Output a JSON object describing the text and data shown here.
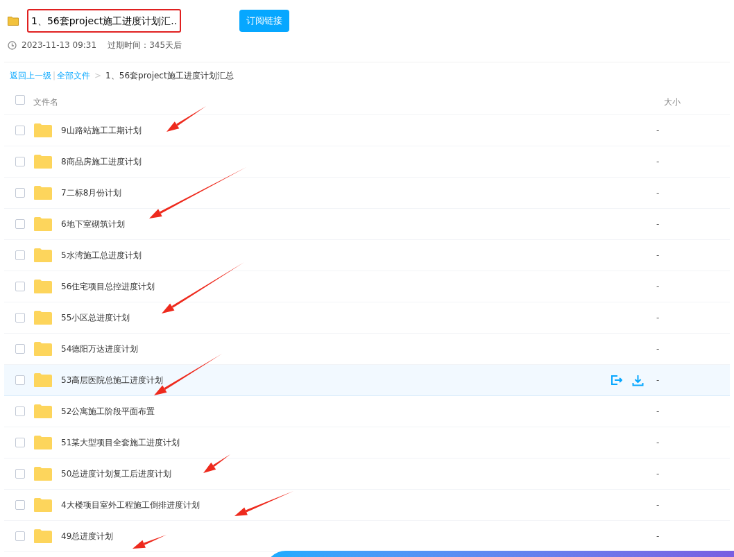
{
  "header": {
    "title": "1、56套project施工进度计划汇..",
    "subscribe_button": "订阅链接",
    "created": "2023-11-13 09:31",
    "expiry": "过期时间：345天后"
  },
  "breadcrumb": {
    "back": "返回上一级",
    "separator": "|",
    "root": "全部文件",
    "arrow": ">",
    "current": "1、56套project施工进度计划汇总"
  },
  "table": {
    "columns": [
      "文件名",
      "大小"
    ],
    "all_checked": false,
    "rows": [
      {
        "name": "9山路站施工工期计划",
        "size": "-",
        "checked": false,
        "hovered": false
      },
      {
        "name": "8商品房施工进度计划",
        "size": "-",
        "checked": false,
        "hovered": false
      },
      {
        "name": "7二标8月份计划",
        "size": "-",
        "checked": false,
        "hovered": false
      },
      {
        "name": "6地下室砌筑计划",
        "size": "-",
        "checked": false,
        "hovered": false
      },
      {
        "name": "5水湾施工总进度计划",
        "size": "-",
        "checked": false,
        "hovered": false
      },
      {
        "name": "56住宅项目总控进度计划",
        "size": "-",
        "checked": false,
        "hovered": false
      },
      {
        "name": "55小区总进度计划",
        "size": "-",
        "checked": false,
        "hovered": false
      },
      {
        "name": "54德阳万达进度计划",
        "size": "-",
        "checked": false,
        "hovered": false
      },
      {
        "name": "53高层医院总施工进度计划",
        "size": "-",
        "checked": false,
        "hovered": true
      },
      {
        "name": "52公寓施工阶段平面布置",
        "size": "-",
        "checked": false,
        "hovered": false
      },
      {
        "name": "51某大型项目全套施工进度计划",
        "size": "-",
        "checked": false,
        "hovered": false
      },
      {
        "name": "50总进度计划复工后进度计划",
        "size": "-",
        "checked": false,
        "hovered": false
      },
      {
        "name": "4大楼项目室外工程施工倒排进度计划",
        "size": "-",
        "checked": false,
        "hovered": false
      },
      {
        "name": "49总进度计划",
        "size": "-",
        "checked": false,
        "hovered": false
      }
    ]
  }
}
